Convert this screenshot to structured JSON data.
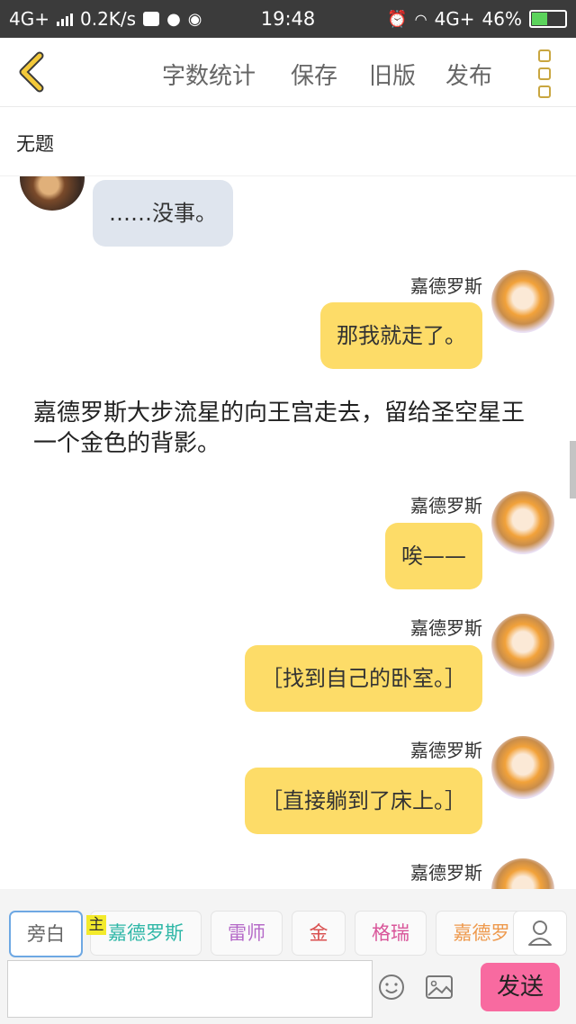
{
  "status_bar": {
    "network": "4G+",
    "speed": "0.2K/s",
    "time": "19:48",
    "network_right": "4G+",
    "battery_percent": "46%",
    "battery_level": 0.46
  },
  "toolbar": {
    "word_count": "字数统计",
    "save": "保存",
    "old_version": "旧版",
    "publish": "发布"
  },
  "title": "无题",
  "messages": {
    "m1": {
      "text": "……没事。"
    },
    "m2": {
      "name": "嘉德罗斯",
      "text": "那我就走了。"
    },
    "narration": "嘉德罗斯大步流星的向王宫走去，留给圣空星王一个金色的背影。",
    "m3": {
      "name": "嘉德罗斯",
      "text": "唉——"
    },
    "m4": {
      "name": "嘉德罗斯",
      "text": "［找到自己的卧室。］"
    },
    "m5": {
      "name": "嘉德罗斯",
      "text": "［直接躺到了床上。］"
    },
    "m6": {
      "name": "嘉德罗斯"
    }
  },
  "roles": {
    "narrator": "旁白",
    "main_badge": "主",
    "r1": "嘉德罗斯",
    "r2": "雷师",
    "r3": "金",
    "r4": "格瑞",
    "r5": "嘉德罗"
  },
  "role_colors": {
    "narrator": "#666666",
    "r1": "#2fb7a7",
    "r2": "#b56ac8",
    "r3": "#d95050",
    "r4": "#d9569a",
    "r5": "#ee9a4e"
  },
  "input": {
    "placeholder": ""
  },
  "send_label": "发送",
  "icons": {
    "back": "chevron-left-icon",
    "more": "more-vertical-icon",
    "emoji": "smiley-icon",
    "image": "image-icon",
    "user": "user-icon"
  }
}
